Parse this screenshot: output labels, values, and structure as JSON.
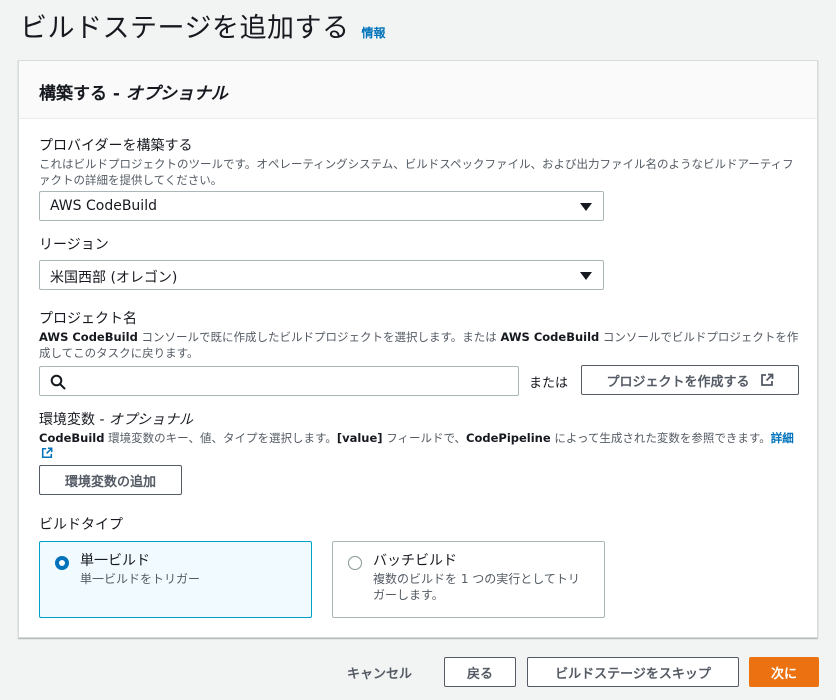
{
  "header": {
    "title": "ビルドステージを追加する",
    "info_link": "情報"
  },
  "panel": {
    "title_main": "構築する - ",
    "title_optional": "オプショナル"
  },
  "provider": {
    "label": "プロバイダーを構築する",
    "description": "これはビルドプロジェクトのツールです。オペレーティングシステム、ビルドスペックファイル、および出力ファイル名のようなビルドアーティファクトの詳細を提供してください。",
    "selected": "AWS CodeBuild"
  },
  "region": {
    "label": "リージョン",
    "selected": "米国西部 (オレゴン)"
  },
  "project": {
    "label": "プロジェクト名",
    "desc_part1": "AWS CodeBuild",
    "desc_part2": " コンソールで既に作成したビルドプロジェクトを選択します。または ",
    "desc_part3": "AWS CodeBuild",
    "desc_part4": " コンソールでビルドプロジェクトを作成してこのタスクに戻ります。",
    "search_value": "",
    "or_text": "または",
    "create_button": "プロジェクトを作成する"
  },
  "env": {
    "label": "環境変数 - ",
    "label_optional": "オプショナル",
    "desc_part1": "CodeBuild",
    "desc_part2": " 環境変数のキー、値、タイプを選択します。",
    "desc_part3": "[value]",
    "desc_part4": " フィールドで、",
    "desc_part5": "CodePipeline",
    "desc_part6": " によって生成された変数を参照できます。",
    "details_link": "詳細",
    "add_button": "環境変数の追加"
  },
  "build_type": {
    "label": "ビルドタイプ",
    "options": [
      {
        "title": "単一ビルド",
        "description": "単一ビルドをトリガー",
        "selected": true
      },
      {
        "title": "バッチビルド",
        "description": "複数のビルドを 1 つの実行としてトリガーします。",
        "selected": false
      }
    ]
  },
  "footer": {
    "cancel": "キャンセル",
    "back": "戻る",
    "skip": "ビルドステージをスキップ",
    "next": "次に"
  },
  "colors": {
    "primary": "#ec7211",
    "link": "#0073bb",
    "selected_border": "#00a1c9"
  }
}
